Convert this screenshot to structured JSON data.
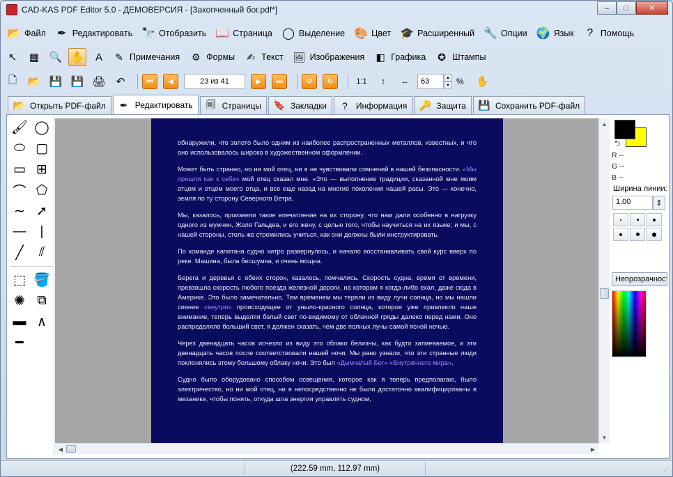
{
  "window": {
    "title": "CAD-KAS PDF Editor 5.0 - ДЕМОВЕРСИЯ - [Закопченный бог.pdf*]",
    "minimize": "–",
    "maximize": "□",
    "close": "✕"
  },
  "menu": [
    {
      "label": "Файл",
      "icon": "folder-icon",
      "glyph": "📂"
    },
    {
      "label": "Редактировать",
      "icon": "pen-icon",
      "glyph": "✒"
    },
    {
      "label": "Отобразить",
      "icon": "binoculars-icon",
      "glyph": "🔭"
    },
    {
      "label": "Страница",
      "icon": "book-icon",
      "glyph": "📖"
    },
    {
      "label": "Выделение",
      "icon": "lasso-icon",
      "glyph": "◯"
    },
    {
      "label": "Цвет",
      "icon": "color-wheel-icon",
      "glyph": "🎨"
    },
    {
      "label": "Расширенный",
      "icon": "graduation-cap-icon",
      "glyph": "🎓"
    },
    {
      "label": "Опции",
      "icon": "wrench-icon",
      "glyph": "🔧"
    },
    {
      "label": "Язык",
      "icon": "globe-icon",
      "glyph": "🌍"
    },
    {
      "label": "Помощь",
      "icon": "help-icon",
      "glyph": "?"
    }
  ],
  "toolbar1": {
    "icons": [
      {
        "name": "select-arrow-icon",
        "glyph": "↖",
        "active": false
      },
      {
        "name": "select-rect-icon",
        "glyph": "▦",
        "active": false
      },
      {
        "name": "zoom-icon",
        "glyph": "🔍",
        "active": false
      },
      {
        "name": "hand-icon",
        "glyph": "✋",
        "active": true
      },
      {
        "name": "text-frame-icon",
        "glyph": "A",
        "active": false
      }
    ],
    "labeled": [
      {
        "label": "Примечания",
        "icon": "notes-icon",
        "glyph": "✎"
      },
      {
        "label": "Формы",
        "icon": "forms-icon",
        "glyph": "⚙"
      },
      {
        "label": "Текст",
        "icon": "text-tool-icon",
        "glyph": "✍"
      },
      {
        "label": "Изображения",
        "icon": "images-icon",
        "glyph": "🖼"
      },
      {
        "label": "Графика",
        "icon": "graphics-icon",
        "glyph": "◧"
      },
      {
        "label": "Штампы",
        "icon": "stamp-icon",
        "glyph": "✪"
      }
    ]
  },
  "toolbar2": {
    "file_icons": [
      {
        "name": "new-document-icon",
        "glyph": "🗋"
      },
      {
        "name": "open-folder-icon",
        "glyph": "📂"
      },
      {
        "name": "save-icon",
        "glyph": "💾"
      },
      {
        "name": "save-as-icon",
        "glyph": "💾"
      },
      {
        "name": "print-icon",
        "glyph": "🖨"
      },
      {
        "name": "undo-icon",
        "glyph": "↶"
      }
    ],
    "page_indicator": "23 из 41",
    "zoom_value": "63",
    "zoom_unit": "%",
    "fit_icons": [
      {
        "name": "actual-size-icon",
        "glyph": "1:1"
      },
      {
        "name": "fit-height-icon",
        "glyph": "↕"
      },
      {
        "name": "fit-width-icon",
        "glyph": "↔"
      }
    ]
  },
  "tabs": [
    {
      "label": "Открыть PDF-файл",
      "icon": "open-pdf-icon",
      "glyph": "📂",
      "active": false
    },
    {
      "label": "Редактировать",
      "icon": "edit-pen-icon",
      "glyph": "✒",
      "active": true
    },
    {
      "label": "Страницы",
      "icon": "pages-icon",
      "glyph": "🗐",
      "active": false
    },
    {
      "label": "Закладки",
      "icon": "bookmarks-icon",
      "glyph": "🔖",
      "active": false
    },
    {
      "label": "Информация",
      "icon": "info-icon",
      "glyph": "?",
      "active": false
    },
    {
      "label": "Защита",
      "icon": "key-icon",
      "glyph": "🔑",
      "active": false
    },
    {
      "label": "Сохранить PDF-файл",
      "icon": "save-pdf-icon",
      "glyph": "💾",
      "active": false
    }
  ],
  "drawing_tools": [
    {
      "name": "brush-icon",
      "glyph": "🖌"
    },
    {
      "name": "circle-icon",
      "glyph": "◯"
    },
    {
      "name": "ellipse-icon",
      "glyph": "⬭"
    },
    {
      "name": "square-icon",
      "glyph": "▢"
    },
    {
      "name": "rectangle-icon",
      "glyph": "▭"
    },
    {
      "name": "grid-icon",
      "glyph": "⊞"
    },
    {
      "name": "freeform-icon",
      "glyph": "⌒"
    },
    {
      "name": "polygon-icon",
      "glyph": "⬠"
    },
    {
      "name": "curve-icon",
      "glyph": "∼"
    },
    {
      "name": "arrow-icon",
      "glyph": "➚"
    },
    {
      "name": "horizontal-line-icon",
      "glyph": "—"
    },
    {
      "name": "vertical-line-icon",
      "glyph": "|"
    },
    {
      "name": "diagonal-line-icon",
      "glyph": "╱"
    },
    {
      "name": "double-line-icon",
      "glyph": "⫽"
    },
    {
      "name": "divider",
      "glyph": ""
    },
    {
      "name": "dashed-select-icon",
      "glyph": "⬚"
    },
    {
      "name": "fill-bucket-icon",
      "glyph": "🪣"
    },
    {
      "name": "effects-icon",
      "glyph": "✺"
    },
    {
      "name": "transform-icon",
      "glyph": "⧉"
    },
    {
      "name": "thick-line-icon",
      "glyph": "▬"
    },
    {
      "name": "angle-icon",
      "glyph": "∧"
    },
    {
      "name": "line-icon",
      "glyph": "━"
    }
  ],
  "document": {
    "paragraphs": [
      [
        {
          "t": "обнаружили, что золото было одним из наиболее распространенных металлов, известных, и что оно использовалось широко в художественном оформлении."
        }
      ],
      [
        {
          "t": "Может быть странно, но ни мой отец, ни я не чувствовали сомнений в нашей безопасности. "
        },
        {
          "t": "«Мы пришли как к себе»",
          "hl": true
        },
        {
          "t": " мой отец сказал мне. «Это — выполнение традиции, сказанной мне моим отцом и отцом моего отца, и все еще назад на многие поколения нашей расы. Это — конечно, земля по ту сторону Северного Ветра."
        }
      ],
      [
        {
          "t": "Мы, казалось, произвели такое впечатление на их сторону, что нам дали особенно в нагрузку одного из мужчин, Жоля Гальдеа, и его жену, с целью того, чтобы научиться на их языке; и мы, с нашей стороны, столь же стремились учиться, как они должны были инструктировать."
        }
      ],
      [
        {
          "t": "По команде капитана судно хитро развернулось, и начало восстанавливать свой курс вверх по реке. Машина, была бесшумна, и очень мощна."
        }
      ],
      [
        {
          "t": "Берега и деревья с обеих сторон, казалось, помчались. Скорость судна, время от времени, превзошла скорость любого поезда железной дороги, на котором я когда-либо ехал, даже сюда в Америке. Это было замечательно. Тем временем мы теряли из виду лучи солнца, но мы нашли сияние "
        },
        {
          "t": "«внутри»",
          "hl": true
        },
        {
          "t": " происходящее от уныло-красного солнца, которое уже привлекло наше внимание, теперь выделяя белый свет по-видимому от облачной гряды далеко перед нами. Оно распределяло больший свет, я должен сказать, чем две полных луны самой ясной ночью."
        }
      ],
      [
        {
          "t": "Через двенадцать часов исчезло из виду это облако белизны, как будто затмеваемое, и эти двенадцать часов после соответствовали нашей ночи. Мы рано узнали, что эти странные люди поклонялись этому большому облаку ночи. Это был "
        },
        {
          "t": "«Дымчатый Бог» «Внутреннего мира»",
          "hl": true
        },
        {
          "t": "."
        }
      ],
      [
        {
          "t": "Судно было оборудовано способом освещения, которое как я теперь предполагаю, было электричество, но ни мой отец, ни я непосредственно не были достаточно квалифицированы в механике, чтобы понять, откуда шла энергия управлять судном,"
        }
      ]
    ]
  },
  "properties": {
    "fg_color": "#000000",
    "bg_color": "#ffff00",
    "r_label": "R --",
    "g_label": "G --",
    "b_label": "B --",
    "line_width_label": "Ширина линии:",
    "line_width_value": "1.00",
    "opacity_button": "Непрозрачность"
  },
  "status": {
    "coordinates": "(222.59 mm, 112.97 mm)"
  }
}
